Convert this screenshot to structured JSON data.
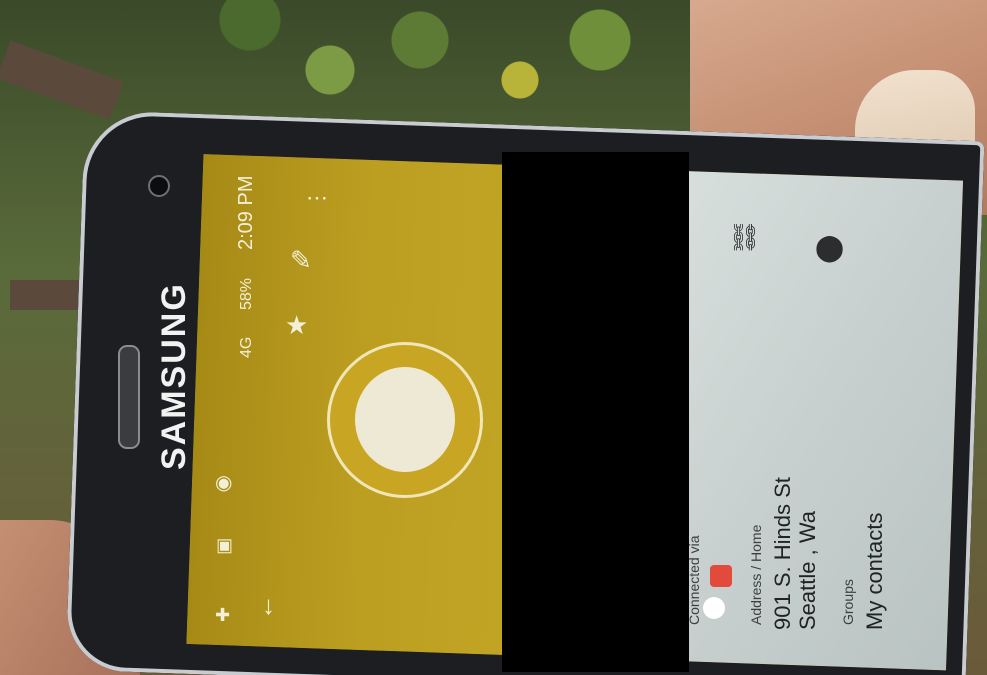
{
  "status_bar": {
    "time": "2:09 PM",
    "battery": "58%",
    "network": "4G"
  },
  "device": {
    "brand": "SAMSUNG"
  },
  "contact_details": {
    "connected_via_label": "Connected via",
    "address_label": "Address / Home",
    "address_line1": "901 S. Hinds St",
    "address_line2": "Seattle , Wa",
    "groups_label": "Groups",
    "groups_value": "My contacts"
  },
  "icons": {
    "back": "arrow-down-icon",
    "more": "more-vertical-icon",
    "edit": "pencil-icon",
    "favorite": "star-icon",
    "link": "link-icon",
    "location": "location-pin-icon"
  },
  "colors": {
    "header": "#b4961c",
    "detail_panel": "#d0d8d6",
    "redaction": "#000000"
  }
}
